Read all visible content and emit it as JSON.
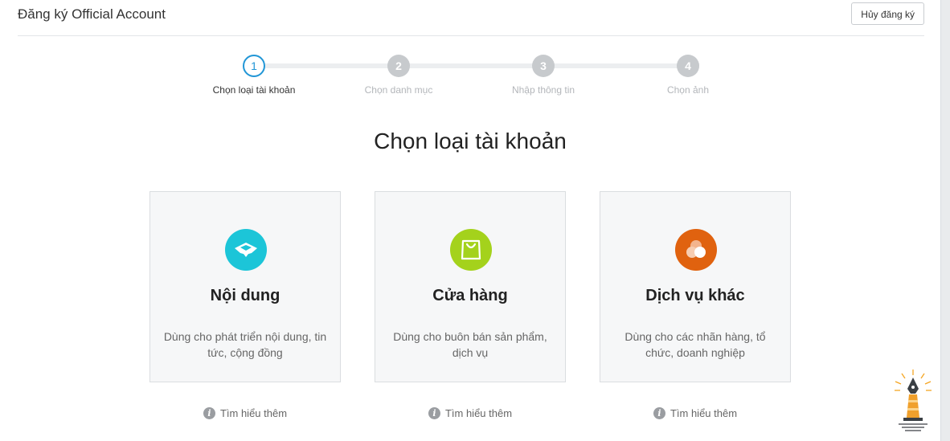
{
  "header": {
    "title": "Đăng ký Official Account",
    "cancel_label": "Hủy đăng ký"
  },
  "stepper": {
    "steps": [
      {
        "number": "1",
        "label": "Chọn loại tài khoản"
      },
      {
        "number": "2",
        "label": "Chọn danh mục"
      },
      {
        "number": "3",
        "label": "Nhập thông tin"
      },
      {
        "number": "4",
        "label": "Chọn ảnh"
      }
    ],
    "active_step": 1
  },
  "main": {
    "heading": "Chọn loại tài khoản",
    "cards": [
      {
        "icon": "content-icon",
        "color": "#1cc5d8",
        "title": "Nội dung",
        "description": "Dùng cho phát triển nội dung, tin tức, cộng đồng",
        "learn_more": "Tìm hiểu thêm"
      },
      {
        "icon": "shopping-bag-icon",
        "color": "#a4d21c",
        "title": "Cửa hàng",
        "description": "Dùng cho buôn bán sản phẩm, dịch vụ",
        "learn_more": "Tìm hiểu thêm"
      },
      {
        "icon": "services-icon",
        "color": "#e0620f",
        "title": "Dịch vụ khác",
        "description": "Dùng cho các nhãn hàng, tổ chức, doanh nghiệp",
        "learn_more": "Tìm hiểu thêm"
      }
    ]
  },
  "colors": {
    "accent": "#2196d6",
    "inactive_step": "#c7cacd"
  }
}
